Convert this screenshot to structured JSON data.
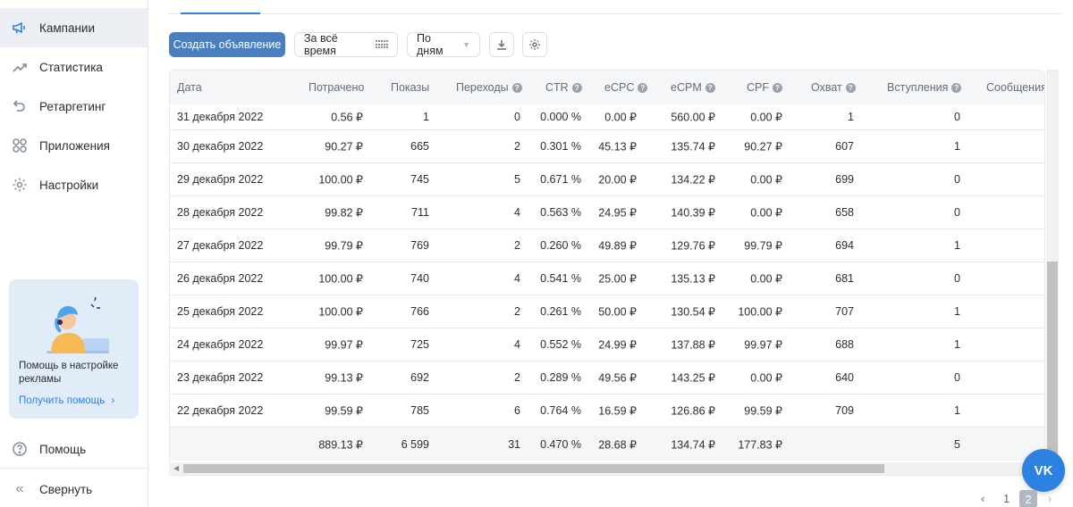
{
  "sidebar": {
    "items": [
      {
        "label": "Кампании",
        "icon": "megaphone-icon"
      },
      {
        "label": "Статистика",
        "icon": "chart-line-icon"
      },
      {
        "label": "Ретаргетинг",
        "icon": "retarget-icon"
      },
      {
        "label": "Приложения",
        "icon": "apps-grid-icon"
      },
      {
        "label": "Настройки",
        "icon": "gear-icon"
      }
    ],
    "help_card": {
      "title": "Помощь в настройке рекламы",
      "link": "Получить помощь"
    },
    "help": "Помощь",
    "collapse": "Свернуть"
  },
  "toolbar": {
    "create_label": "Создать объявление",
    "period_label": "За всё время",
    "group_label": "По дням"
  },
  "table": {
    "headers": [
      "Дата",
      "Потрачено",
      "Показы",
      "Переходы",
      "CTR",
      "eCPC",
      "eCPM",
      "CPF",
      "Охват",
      "Вступления",
      "Сообщения"
    ],
    "rows": [
      [
        "31 декабря 2022",
        "0.56 ₽",
        "1",
        "0",
        "0.000 %",
        "0.00 ₽",
        "560.00 ₽",
        "0.00 ₽",
        "1",
        "0"
      ],
      [
        "30 декабря 2022",
        "90.27 ₽",
        "665",
        "2",
        "0.301 %",
        "45.13 ₽",
        "135.74 ₽",
        "90.27 ₽",
        "607",
        "1"
      ],
      [
        "29 декабря 2022",
        "100.00 ₽",
        "745",
        "5",
        "0.671 %",
        "20.00 ₽",
        "134.22 ₽",
        "0.00 ₽",
        "699",
        "0"
      ],
      [
        "28 декабря 2022",
        "99.82 ₽",
        "711",
        "4",
        "0.563 %",
        "24.95 ₽",
        "140.39 ₽",
        "0.00 ₽",
        "658",
        "0"
      ],
      [
        "27 декабря 2022",
        "99.79 ₽",
        "769",
        "2",
        "0.260 %",
        "49.89 ₽",
        "129.76 ₽",
        "99.79 ₽",
        "694",
        "1"
      ],
      [
        "26 декабря 2022",
        "100.00 ₽",
        "740",
        "4",
        "0.541 %",
        "25.00 ₽",
        "135.13 ₽",
        "0.00 ₽",
        "681",
        "0"
      ],
      [
        "25 декабря 2022",
        "100.00 ₽",
        "766",
        "2",
        "0.261 %",
        "50.00 ₽",
        "130.54 ₽",
        "100.00 ₽",
        "707",
        "1"
      ],
      [
        "24 декабря 2022",
        "99.97 ₽",
        "725",
        "4",
        "0.552 %",
        "24.99 ₽",
        "137.88 ₽",
        "99.97 ₽",
        "688",
        "1"
      ],
      [
        "23 декабря 2022",
        "99.13 ₽",
        "692",
        "2",
        "0.289 %",
        "49.56 ₽",
        "143.25 ₽",
        "0.00 ₽",
        "640",
        "0"
      ],
      [
        "22 декабря 2022",
        "99.59 ₽",
        "785",
        "6",
        "0.764 %",
        "16.59 ₽",
        "126.86 ₽",
        "99.59 ₽",
        "709",
        "1"
      ]
    ],
    "total": [
      "",
      "889.13 ₽",
      "6 599",
      "31",
      "0.470 %",
      "28.68 ₽",
      "134.74 ₽",
      "177.83 ₽",
      "",
      "5"
    ]
  },
  "pagination": {
    "prev": "‹",
    "pages": [
      "1",
      "2"
    ],
    "next": "›"
  },
  "vk_button": "VK",
  "colors": {
    "accent": "#2d81e0",
    "primary_button": "#4a7fbf",
    "help_card_bg": "#e1ecf9"
  }
}
